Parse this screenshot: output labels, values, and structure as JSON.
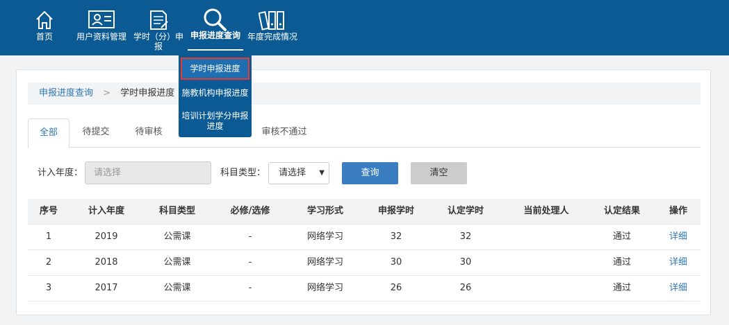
{
  "nav": {
    "items": [
      {
        "label": "首页",
        "icon": "home-icon"
      },
      {
        "label": "用户资料管理",
        "icon": "user-card-icon"
      },
      {
        "label": "学时（分）申报",
        "icon": "document-icon"
      },
      {
        "label": "申报进度查询",
        "icon": "search-icon"
      },
      {
        "label": "年度完成情况",
        "icon": "binders-icon"
      }
    ],
    "nav_item_3_line1": "学时（分）申",
    "nav_item_3_line2": "报"
  },
  "dropdown": {
    "items": [
      "学时申报进度",
      "施教机构申报进度",
      "培训计划学分申报进度"
    ],
    "item3_line1": "培训计划学分申报",
    "item3_line2": "进度"
  },
  "breadcrumb": {
    "parent": "申报进度查询",
    "separator": ">",
    "current": "学时申报进度"
  },
  "tabs": [
    "全部",
    "待提交",
    "待审核",
    "审核不通过"
  ],
  "filters": {
    "year_label": "计入年度：",
    "year_placeholder": "请选择",
    "subject_label": "科目类型：",
    "subject_value": "请选择",
    "query_button": "查询",
    "clear_button": "清空"
  },
  "table": {
    "headers": [
      "序号",
      "计入年度",
      "科目类型",
      "必修/选修",
      "学习形式",
      "申报学时",
      "认定学时",
      "当前处理人",
      "认定结果",
      "操作"
    ],
    "rows": [
      [
        "1",
        "2019",
        "公需课",
        "-",
        "网络学习",
        "32",
        "32",
        "",
        "通过",
        "详细"
      ],
      [
        "2",
        "2018",
        "公需课",
        "-",
        "网络学习",
        "30",
        "30",
        "",
        "通过",
        "详细"
      ],
      [
        "3",
        "2017",
        "公需课",
        "-",
        "网络学习",
        "26",
        "26",
        "",
        "通过",
        "详细"
      ]
    ]
  },
  "colors": {
    "brand": "#0c5a94",
    "link": "#2f77b6",
    "highlight": "#e53935"
  }
}
